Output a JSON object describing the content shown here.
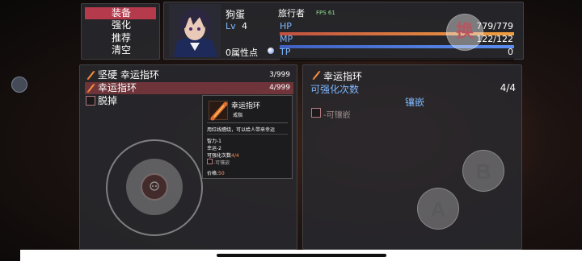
{
  "menu": {
    "items": [
      "装备",
      "强化",
      "推荐",
      "清空"
    ],
    "active_index": 0
  },
  "status": {
    "name": "狗蛋",
    "job": "旅行者",
    "fps": "FPS 61",
    "level_label": "Lv",
    "level": "4",
    "attr_points": "0属性点",
    "hp_label": "HP",
    "hp_value": "779/779",
    "hp_fraction": 1.0,
    "mp_label": "MP",
    "mp_value": "122/122",
    "mp_fraction": 1.0,
    "tp_label": "TP",
    "tp_value": "0",
    "tp_fraction": 0
  },
  "item_list": {
    "rows": [
      {
        "name": "坚硬 幸运指环",
        "qty": "3/999",
        "icon": "ring-icon",
        "selected": false
      },
      {
        "name": "幸运指环",
        "qty": "4/999",
        "icon": "ring-icon",
        "selected": true
      },
      {
        "name": "脱掉",
        "qty": "",
        "icon": "checkbox",
        "selected": false
      }
    ]
  },
  "detail": {
    "title": "幸运指环",
    "enhance_label": "可强化次数",
    "enhance_value": "4/4",
    "socket_label": "镶嵌",
    "socket_checkbox_label": "-可镶嵌"
  },
  "tooltip": {
    "title": "幸运指环",
    "subtitle": "戒指",
    "description": "用红线缠绕，可以给人带来幸运",
    "stats": [
      "智力-1",
      "幸运-2"
    ],
    "enhance_label": "可强化次数",
    "enhance_value": "4/4",
    "socket_label": "-可镶嵌",
    "price_label": "价格:",
    "price_value": "50"
  },
  "controls": {
    "swap_label": "换",
    "a_label": "A",
    "b_label": "B"
  },
  "colors": {
    "menu_active": "#b43a4c",
    "hp": "#f0a040",
    "mp": "#5a8ef0",
    "tp": "#c0c0c0",
    "highlight": "#7fb8ff",
    "price": "#ff9a6a",
    "enhance_count": "#ff8a50"
  }
}
